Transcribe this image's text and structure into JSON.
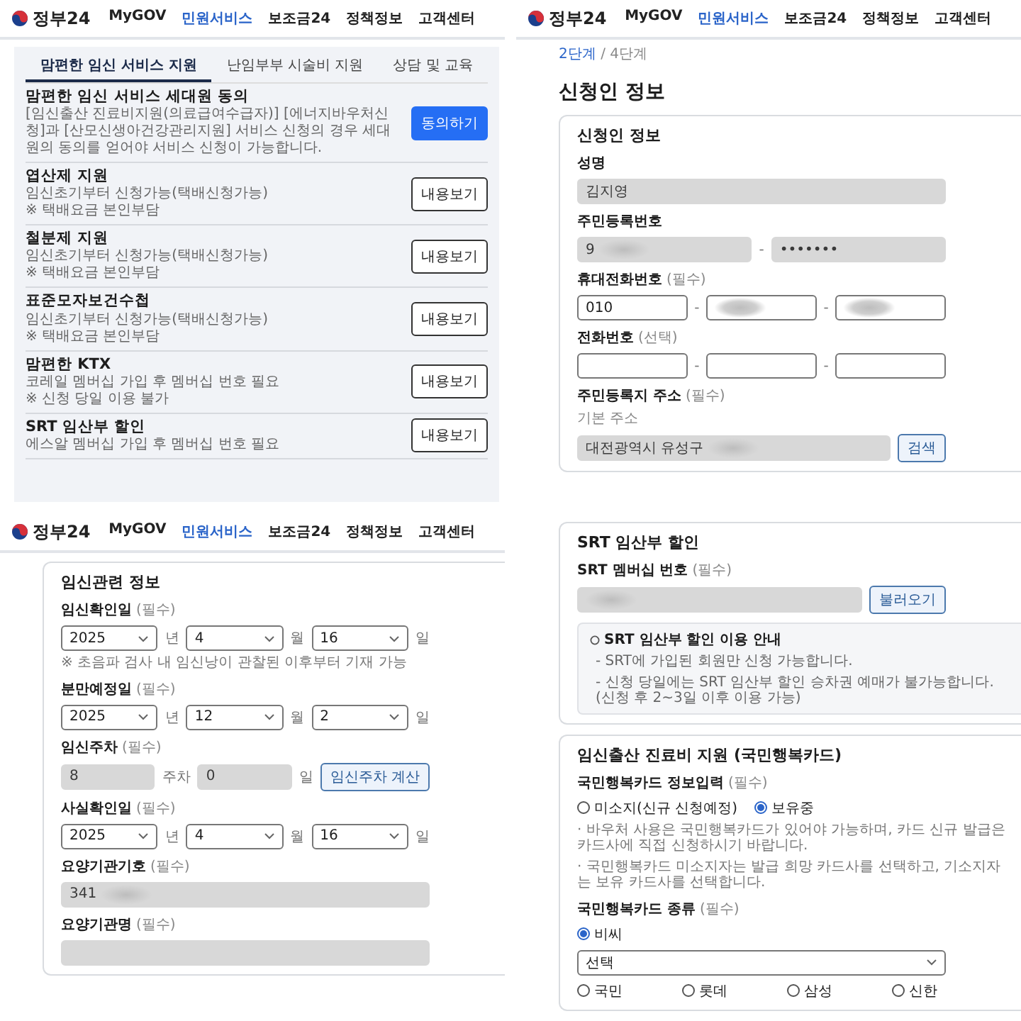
{
  "panels": [
    {
      "kind": "service_list",
      "header": {
        "logo": "정부24",
        "nav": [
          {
            "label": "MyGOV",
            "selected": false
          },
          {
            "label": "민원서비스",
            "selected": true
          },
          {
            "label": "보조금24",
            "selected": false
          },
          {
            "label": "정책정보",
            "selected": false
          },
          {
            "label": "고객센터",
            "selected": false
          }
        ]
      },
      "tabs": [
        {
          "label": "맘편한 임신 서비스 지원",
          "selected": true
        },
        {
          "label": "난임부부 시술비 지원",
          "selected": false
        },
        {
          "label": "상담 및 교육",
          "selected": false
        }
      ],
      "items": [
        {
          "title": "맘편한 임신 서비스 세대원 동의",
          "description": "[임신출산 진료비지원(의료급여수급자)] [에너지바우처신청]과 [산모신생아건강관리지원] 서비스 신청의 경우 세대원의 동의를 얻어야 서비스 신청이 가능합니다.",
          "button": {
            "label": "동의하기",
            "kind": "primary"
          }
        },
        {
          "title": "엽산제 지원",
          "description": "임신초기부터 신청가능(택배신청가능)",
          "note": "※ 택배요금 본인부담",
          "button": {
            "label": "내용보기",
            "kind": "outline"
          }
        },
        {
          "title": "철분제 지원",
          "description": "임신초기부터 신청가능(택배신청가능)",
          "note": "※ 택배요금 본인부담",
          "button": {
            "label": "내용보기",
            "kind": "outline"
          }
        },
        {
          "title": "표준모자보건수첩",
          "description": "임신초기부터 신청가능(택배신청가능)",
          "note": "※ 택배요금 본인부담",
          "button": {
            "label": "내용보기",
            "kind": "outline"
          }
        },
        {
          "title": "맘편한 KTX",
          "description": "코레일 멤버십 가입 후 멤버십 번호 필요",
          "note": "※ 신청 당일 이용 불가",
          "button": {
            "label": "내용보기",
            "kind": "outline"
          }
        },
        {
          "title": "SRT 임산부 할인",
          "description": "에스알 멤버십 가입 후 멤버십 번호 필요",
          "button": {
            "label": "내용보기",
            "kind": "outline"
          }
        }
      ]
    },
    {
      "kind": "form",
      "header": {
        "logo": "정부24",
        "nav": [
          {
            "label": "MyGOV",
            "selected": false
          },
          {
            "label": "민원서비스",
            "selected": true
          },
          {
            "label": "보조금24",
            "selected": false
          },
          {
            "label": "정책정보",
            "selected": false
          },
          {
            "label": "고객센터",
            "selected": false
          }
        ]
      },
      "breadcrumb": {
        "step": "2단계",
        "of": "/ 4단계"
      },
      "title": "신청인 정보",
      "cards": [
        {
          "title": "신청인 정보",
          "fields": [
            {
              "label": "성명",
              "rows": [
                [
                  {
                    "kind": "input",
                    "value": "김지영",
                    "disabled": true
                  }
                ]
              ]
            },
            {
              "label": "주민등록번호",
              "rows": [
                [
                  {
                    "kind": "input",
                    "value": "9",
                    "disabled": true,
                    "redacted": true
                  },
                  {
                    "kind": "unit",
                    "text": "-"
                  },
                  {
                    "kind": "input",
                    "value": "•••••••",
                    "disabled": true,
                    "redacted": false
                  }
                ]
              ]
            },
            {
              "label": "휴대전화번호",
              "tag": "(필수)",
              "rows": [
                [
                  {
                    "kind": "input",
                    "value": "010",
                    "disabled": false
                  },
                  {
                    "kind": "unit",
                    "text": "-"
                  },
                  {
                    "kind": "input",
                    "disabled": false,
                    "redacted": true
                  },
                  {
                    "kind": "unit",
                    "text": "-"
                  },
                  {
                    "kind": "input",
                    "disabled": false,
                    "redacted": true
                  }
                ]
              ]
            },
            {
              "label": "전화번호",
              "tag": "(선택)",
              "rows": [
                [
                  {
                    "kind": "input",
                    "disabled": false
                  },
                  {
                    "kind": "unit",
                    "text": "-"
                  },
                  {
                    "kind": "input",
                    "disabled": false
                  },
                  {
                    "kind": "unit",
                    "text": "-"
                  },
                  {
                    "kind": "input",
                    "disabled": false
                  }
                ]
              ]
            },
            {
              "label": "주민등록지 주소",
              "tag": "(필수)",
              "sublabel": "기본 주소",
              "rows": [
                [
                  {
                    "kind": "input",
                    "value": "대전광역시 유성구",
                    "disabled": true,
                    "redacted": true
                  },
                  {
                    "kind": "button",
                    "label": "검색"
                  }
                ]
              ]
            }
          ]
        }
      ]
    },
    {
      "kind": "form",
      "header": {
        "logo": "정부24",
        "nav": [
          {
            "label": "MyGOV",
            "selected": false
          },
          {
            "label": "민원서비스",
            "selected": true
          },
          {
            "label": "보조금24",
            "selected": false
          },
          {
            "label": "정책정보",
            "selected": false
          },
          {
            "label": "고객센터",
            "selected": false
          }
        ]
      },
      "cards": [
        {
          "title": "임신관련 정보",
          "fields": [
            {
              "label": "임신확인일",
              "tag": "(필수)",
              "rows": [
                [
                  {
                    "kind": "select",
                    "value": "2025"
                  },
                  {
                    "kind": "unit",
                    "text": "년"
                  },
                  {
                    "kind": "select",
                    "value": "4"
                  },
                  {
                    "kind": "unit",
                    "text": "월"
                  },
                  {
                    "kind": "select",
                    "value": "16"
                  },
                  {
                    "kind": "unit",
                    "text": "일"
                  }
                ]
              ],
              "notes": [
                "※ 초음파 검사 내 임신낭이 관찰된 이후부터 기재 가능"
              ]
            },
            {
              "label": "분만예정일",
              "tag": "(필수)",
              "rows": [
                [
                  {
                    "kind": "select",
                    "value": "2025"
                  },
                  {
                    "kind": "unit",
                    "text": "년"
                  },
                  {
                    "kind": "select",
                    "value": "12"
                  },
                  {
                    "kind": "unit",
                    "text": "월"
                  },
                  {
                    "kind": "select",
                    "value": "2"
                  },
                  {
                    "kind": "unit",
                    "text": "일"
                  }
                ]
              ]
            },
            {
              "label": "임신주차",
              "tag": "(필수)",
              "rows": [
                [
                  {
                    "kind": "input",
                    "value": "8",
                    "disabled": true
                  },
                  {
                    "kind": "unit",
                    "text": "주차"
                  },
                  {
                    "kind": "input",
                    "value": "0",
                    "disabled": true
                  },
                  {
                    "kind": "unit",
                    "text": "일"
                  },
                  {
                    "kind": "button",
                    "label": "임신주차 계산"
                  }
                ]
              ]
            },
            {
              "label": "사실확인일",
              "tag": "(필수)",
              "rows": [
                [
                  {
                    "kind": "select",
                    "value": "2025"
                  },
                  {
                    "kind": "unit",
                    "text": "년"
                  },
                  {
                    "kind": "select",
                    "value": "4"
                  },
                  {
                    "kind": "unit",
                    "text": "월"
                  },
                  {
                    "kind": "select",
                    "value": "16"
                  },
                  {
                    "kind": "unit",
                    "text": "일"
                  }
                ]
              ]
            },
            {
              "label": "요양기관기호",
              "tag": "(필수)",
              "rows": [
                [
                  {
                    "kind": "input",
                    "value": "341",
                    "disabled": true,
                    "redacted": true
                  }
                ]
              ]
            },
            {
              "label": "요양기관명",
              "tag": "(필수)",
              "rows": [
                [
                  {
                    "kind": "input",
                    "disabled": true
                  }
                ]
              ]
            }
          ]
        }
      ]
    },
    {
      "kind": "form",
      "cards": [
        {
          "title": "SRT 임산부 할인",
          "fields": [
            {
              "label": "SRT 멤버십 번호",
              "tag": "(필수)",
              "rows": [
                [
                  {
                    "kind": "input",
                    "disabled": true,
                    "redacted": true
                  },
                  {
                    "kind": "button",
                    "label": "불러오기"
                  }
                ]
              ]
            }
          ],
          "info": {
            "title": "SRT 임산부 할인 이용 안내",
            "lines": [
              "- SRT에 가입된 회원만 신청 가능합니다.",
              "- 신청 당일에는 SRT 임산부 할인 승차권 예매가 불가능합니다. (신청 후 2~3일 이후 이용 가능)"
            ]
          }
        },
        {
          "title": "임신출산 진료비 지원 (국민행복카드)",
          "fields": [
            {
              "label": "국민행복카드 정보입력",
              "tag": "(필수)",
              "rows": [
                [
                  {
                    "kind": "radio",
                    "label": "미소지(신규 신청예정)",
                    "selected": false
                  },
                  {
                    "kind": "radio",
                    "label": "보유중",
                    "selected": true
                  }
                ]
              ],
              "notes": [
                "· 바우처 사용은 국민행복카드가 있어야 가능하며, 카드 신규 발급은 카드사에 직접 신청하시기 바랍니다.",
                "· 국민행복카드 미소지자는 발급 희망 카드사를 선택하고, 기소지자는 보유 카드사를 선택합니다."
              ]
            },
            {
              "label": "국민행복카드 종류",
              "tag": "(필수)",
              "rows": [
                [
                  {
                    "kind": "radio",
                    "label": "비씨",
                    "selected": true
                  }
                ],
                [
                  {
                    "kind": "select",
                    "value": "선택"
                  }
                ],
                [
                  {
                    "kind": "radio",
                    "label": "국민",
                    "selected": false
                  },
                  {
                    "kind": "radio",
                    "label": "롯데",
                    "selected": false
                  },
                  {
                    "kind": "radio",
                    "label": "삼성",
                    "selected": false
                  },
                  {
                    "kind": "radio",
                    "label": "신한",
                    "selected": false
                  }
                ]
              ]
            }
          ]
        }
      ]
    }
  ]
}
